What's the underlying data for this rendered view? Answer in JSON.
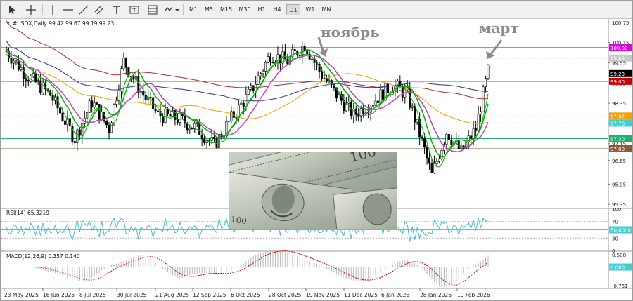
{
  "toolbar": {
    "timeframes": [
      "M1",
      "M5",
      "M15",
      "M30",
      "H1",
      "H4",
      "D1",
      "W1",
      "MN"
    ],
    "active_timeframe": "D1"
  },
  "chart": {
    "title": "#USDX,Daily  99.42 99.67 99.19 99.23",
    "symbol_label": "#USDX,Daily",
    "ohlc": "99.42 99.67 99.19 99.23",
    "y_ticks": [
      "100.75",
      "100.15",
      "99.55",
      "98.95",
      "98.35",
      "97.75",
      "97.15",
      "96.65",
      "95.95",
      "95.35"
    ],
    "price_labels": [
      {
        "text": "100.00",
        "bg": "#e000e0",
        "fg": "#ffffff",
        "value": 100.0
      },
      {
        "text": "99.69",
        "bg": "#c8c8c8",
        "fg": "#ffffff",
        "value": 99.69
      },
      {
        "text": "99.23",
        "bg": "#000000",
        "fg": "#ffffff",
        "value": 99.23
      },
      {
        "text": "99.00",
        "bg": "#cc0000",
        "fg": "#ffffff",
        "value": 99.0
      },
      {
        "text": "97.97",
        "bg": "#f0a000",
        "fg": "#ffffff",
        "value": 97.97
      },
      {
        "text": "97.76",
        "bg": "#40d0d0",
        "fg": "#ffffff",
        "value": 97.76
      },
      {
        "text": "97.30",
        "bg": "#20b070",
        "fg": "#ffffff",
        "value": 97.3
      },
      {
        "text": "97.00",
        "bg": "#8c5a3c",
        "fg": "#ffffff",
        "value": 97.0
      }
    ],
    "annotations": [
      {
        "text": "ноябрь"
      },
      {
        "text": "март"
      }
    ]
  },
  "rsi": {
    "label": "RSI(14) 65.3219",
    "ticks": [
      "100",
      "70",
      "50",
      "30",
      "0"
    ],
    "level_label": "50.0000"
  },
  "macd": {
    "label": "MACD(12,26,9) 0.357 0.140",
    "ticks": [
      "0.508",
      "0.000",
      "-0.761"
    ],
    "zero_label": "0.000"
  },
  "x_axis": {
    "dates": [
      "23 May 2025",
      "16 Jun 2025",
      "8 Jul 2025",
      "30 Jul 2025",
      "21 Aug 2025",
      "12 Sep 2025",
      "6 Oct 2025",
      "28 Oct 2025",
      "19 Nov 2025",
      "11 Dec 2025",
      "6 Jan 2026",
      "28 Jan 2026",
      "19 Feb 2026"
    ]
  },
  "colors": {
    "candle": "#000000",
    "ma_fast": "#00b000",
    "ma_band": "#c040c0",
    "ma_orange": "#f0a000",
    "ma_navy": "#303090",
    "ma_brown": "#a03030",
    "rsi_line": "#40c0d0",
    "macd_signal": "#cc0000"
  },
  "icons": [
    "cursor-icon",
    "crosshair-icon",
    "hline-icon",
    "trendline-icon",
    "channel-icon",
    "text-icon",
    "label-icon",
    "shapes-icon"
  ]
}
